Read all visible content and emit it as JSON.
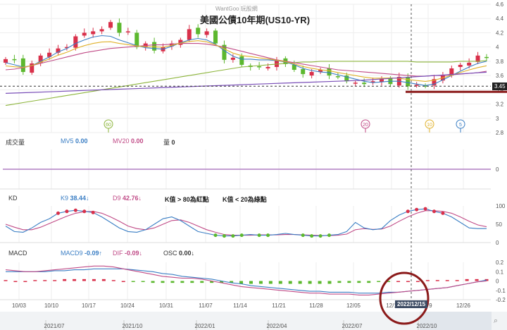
{
  "header": {
    "watermark": "WantGoo 玩股網",
    "title": "美國公債10年期(US10-YR)"
  },
  "price_panel": {
    "y_ticks": [
      "4.6",
      "4.4",
      "4.2",
      "4",
      "3.8",
      "3.6",
      "3.4",
      "3.2",
      "3",
      "2.8"
    ],
    "last_price_tag": "3.45",
    "bubbles": [
      {
        "text": "60",
        "color": "#8db53c",
        "date": "10/18"
      },
      {
        "text": "20",
        "color": "#c04a86",
        "date": "12/05"
      },
      {
        "text": "10",
        "color": "#e0b12a",
        "date": "12/20"
      },
      {
        "text": "5",
        "color": "#3a7ec4",
        "date": "12/23"
      }
    ]
  },
  "volume_panel": {
    "label": "成交量",
    "mv5_label": "MV5",
    "mv5_value": "0.00",
    "mv20_label": "MV20",
    "mv20_value": "0.00",
    "vol_label": "量",
    "vol_value": "0",
    "y_tick": "0"
  },
  "kd_panel": {
    "label": "KD",
    "k_label": "K9",
    "k_value": "38.44↓",
    "d_label": "D9",
    "d_value": "42.76↓",
    "note1": "K值 > 80為紅點",
    "note2": "K值 < 20為綠點",
    "y_ticks": [
      "100",
      "50",
      "0"
    ]
  },
  "macd_panel": {
    "label": "MACD",
    "macd_label": "MACD9",
    "macd_value": "-0.09↑",
    "dif_label": "DIF",
    "dif_value": "-0.09↓",
    "osc_label": "OSC",
    "osc_value": "0.00↓",
    "y_ticks": [
      "0.2",
      "0.1",
      "0",
      "-0.1",
      "-0.2"
    ]
  },
  "x_axis": {
    "ticks": [
      "10/03",
      "10/10",
      "10/17",
      "10/24",
      "10/31",
      "11/07",
      "11/14",
      "11/21",
      "11/28",
      "12/05",
      "12/1",
      "2/9",
      "12/26"
    ],
    "crosshair_label": "2022/12/15"
  },
  "navigator": {
    "ticks": [
      "2021/07",
      "2021/10",
      "2022/01",
      "2022/04",
      "2022/07",
      "2022/10"
    ]
  },
  "colors": {
    "up": "#d9304a",
    "down": "#5cb82e",
    "ma5": "#3a7ec4",
    "ma10": "#e0b12a",
    "ma20": "#c04a86",
    "ma60": "#8db53c",
    "ma240": "#7a4fb8",
    "k": "#3a7ec4",
    "d": "#c04a86",
    "annotation": "#8b1a1a"
  },
  "chart_data": [
    {
      "type": "candlestick",
      "title": "美國公債10年期(US10-YR)",
      "ylim": [
        2.8,
        4.6
      ],
      "series": [
        {
          "name": "MV5",
          "values": [
            3.78,
            3.75,
            3.72,
            3.74,
            3.8,
            3.86,
            3.93,
            3.98,
            4.05,
            4.1,
            4.14,
            4.16,
            4.15,
            4.1,
            4.06,
            4.02,
            3.99,
            3.98,
            3.97,
            4.01,
            4.06,
            4.1,
            4.12,
            4.1,
            4.04,
            3.95,
            3.87,
            3.83,
            3.83,
            3.82,
            3.82,
            3.81,
            3.79,
            3.75,
            3.7,
            3.67,
            3.65,
            3.64,
            3.61,
            3.58,
            3.55,
            3.52,
            3.5,
            3.51,
            3.52,
            3.52,
            3.5,
            3.48,
            3.46,
            3.48,
            3.54,
            3.6,
            3.66,
            3.72,
            3.77,
            3.8
          ]
        },
        {
          "name": "MV20",
          "values": [
            3.68,
            3.69,
            3.71,
            3.74,
            3.77,
            3.8,
            3.83,
            3.86,
            3.89,
            3.92,
            3.94,
            3.96,
            3.98,
            3.99,
            4.0,
            4.01,
            4.02,
            4.03,
            4.03,
            4.04,
            4.05,
            4.05,
            4.05,
            4.04,
            4.02,
            4.0,
            3.97,
            3.94,
            3.91,
            3.88,
            3.85,
            3.82,
            3.8,
            3.78,
            3.76,
            3.74,
            3.72,
            3.7,
            3.68,
            3.67,
            3.66,
            3.65,
            3.64,
            3.63,
            3.62,
            3.61,
            3.6,
            3.59,
            3.59,
            3.6,
            3.6,
            3.61,
            3.62,
            3.63,
            3.64,
            3.66
          ]
        },
        {
          "name": "MV60",
          "values": [
            3.18,
            3.2,
            3.22,
            3.24,
            3.26,
            3.28,
            3.3,
            3.32,
            3.34,
            3.36,
            3.38,
            3.4,
            3.42,
            3.44,
            3.46,
            3.48,
            3.5,
            3.52,
            3.54,
            3.56,
            3.58,
            3.6,
            3.62,
            3.64,
            3.66,
            3.68,
            3.7,
            3.72,
            3.73,
            3.74,
            3.75,
            3.76,
            3.77,
            3.78,
            3.79,
            3.79,
            3.8,
            3.8,
            3.8,
            3.8,
            3.8,
            3.8,
            3.8,
            3.8,
            3.8,
            3.8,
            3.8,
            3.79,
            3.79,
            3.79,
            3.79,
            3.79,
            3.8,
            3.8,
            3.8,
            3.81
          ]
        }
      ],
      "ohlc_close_approx": [
        3.83,
        3.82,
        3.65,
        3.77,
        3.88,
        3.92,
        3.98,
        4.0,
        4.15,
        4.2,
        4.22,
        4.25,
        4.35,
        4.2,
        4.22,
        4.0,
        4.05,
        3.95,
        4.0,
        4.05,
        4.1,
        4.25,
        4.18,
        4.22,
        4.05,
        3.82,
        3.85,
        3.75,
        3.72,
        3.72,
        3.72,
        3.82,
        3.76,
        3.68,
        3.62,
        3.65,
        3.68,
        3.6,
        3.59,
        3.52,
        3.5,
        3.48,
        3.52,
        3.55,
        3.48,
        3.58,
        3.45,
        3.47,
        3.45,
        3.55,
        3.6,
        3.7,
        3.75,
        3.78,
        3.88,
        3.85
      ],
      "last_price": 3.45
    },
    {
      "type": "line",
      "title": "KD",
      "ylim": [
        0,
        100
      ],
      "series": [
        {
          "name": "K9",
          "values": [
            45,
            30,
            28,
            40,
            55,
            65,
            80,
            85,
            88,
            85,
            82,
            70,
            55,
            40,
            30,
            28,
            35,
            50,
            65,
            70,
            60,
            45,
            30,
            25,
            20,
            18,
            18,
            20,
            22,
            20,
            20,
            22,
            25,
            22,
            20,
            18,
            18,
            20,
            22,
            30,
            55,
            40,
            35,
            38,
            60,
            75,
            85,
            90,
            92,
            85,
            80,
            70,
            55,
            40,
            38,
            38
          ]
        },
        {
          "name": "D9",
          "values": [
            50,
            42,
            35,
            35,
            42,
            52,
            62,
            72,
            80,
            84,
            85,
            80,
            70,
            58,
            45,
            38,
            35,
            40,
            50,
            60,
            62,
            55,
            45,
            35,
            28,
            22,
            20,
            20,
            20,
            21,
            21,
            21,
            22,
            22,
            21,
            20,
            19,
            19,
            20,
            23,
            35,
            38,
            36,
            37,
            45,
            58,
            70,
            80,
            87,
            87,
            85,
            80,
            70,
            58,
            48,
            43
          ]
        }
      ]
    },
    {
      "type": "line",
      "title": "MACD",
      "ylim": [
        -0.2,
        0.2
      ],
      "series": [
        {
          "name": "DIF",
          "values": [
            0.12,
            0.11,
            0.1,
            0.1,
            0.11,
            0.12,
            0.13,
            0.14,
            0.15,
            0.16,
            0.16,
            0.15,
            0.13,
            0.11,
            0.09,
            0.07,
            0.05,
            0.04,
            0.03,
            0.03,
            0.02,
            0.0,
            -0.02,
            -0.04,
            -0.06,
            -0.07,
            -0.08,
            -0.09,
            -0.1,
            -0.11,
            -0.12,
            -0.13,
            -0.13,
            -0.14,
            -0.14,
            -0.14,
            -0.15,
            -0.15,
            -0.14,
            -0.13,
            -0.12,
            -0.11,
            -0.1,
            -0.09,
            -0.08,
            -0.07,
            -0.05,
            -0.03,
            -0.01,
            0.0
          ]
        },
        {
          "name": "MACD9",
          "values": [
            0.1,
            0.1,
            0.1,
            0.1,
            0.1,
            0.11,
            0.11,
            0.12,
            0.12,
            0.13,
            0.13,
            0.13,
            0.13,
            0.12,
            0.11,
            0.1,
            0.08,
            0.07,
            0.05,
            0.04,
            0.03,
            0.02,
            0.0,
            -0.02,
            -0.03,
            -0.05,
            -0.06,
            -0.07,
            -0.08,
            -0.09,
            -0.1,
            -0.11,
            -0.11,
            -0.12,
            -0.12,
            -0.12,
            -0.13,
            -0.13,
            -0.13,
            -0.12,
            -0.12,
            -0.11,
            -0.1,
            -0.09,
            -0.08,
            -0.07,
            -0.05,
            -0.03,
            -0.01,
            0.01
          ]
        }
      ],
      "osc": [
        0.01,
        0.0,
        0.0,
        0.01,
        0.01,
        0.01,
        0.02,
        0.02,
        0.02,
        0.02,
        0.02,
        0.01,
        0.0,
        -0.01,
        -0.01,
        -0.02,
        -0.02,
        -0.02,
        -0.02,
        -0.02,
        -0.02,
        -0.02,
        -0.02,
        -0.02,
        -0.03,
        -0.03,
        -0.03,
        -0.03,
        -0.03,
        -0.03,
        -0.03,
        -0.03,
        -0.03,
        -0.03,
        -0.02,
        -0.02,
        -0.02,
        -0.02,
        -0.01,
        -0.01,
        0.0,
        0.0,
        0.0,
        0.01,
        0.01,
        0.01,
        0.01,
        0.02,
        0.02,
        0.02
      ]
    }
  ]
}
